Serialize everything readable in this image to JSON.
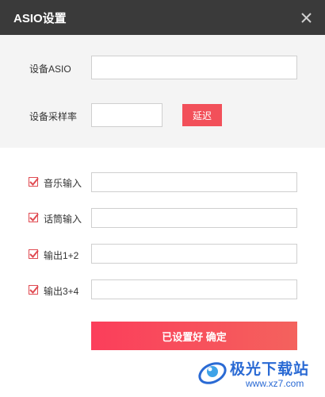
{
  "window": {
    "title": "ASIO设置"
  },
  "device": {
    "label": "设备ASIO",
    "value": ""
  },
  "sample_rate": {
    "label": "设备采样率",
    "value": "",
    "delay_label": "延迟"
  },
  "inputs": [
    {
      "label": "音乐输入",
      "checked": true,
      "value": ""
    },
    {
      "label": "话筒输入",
      "checked": true,
      "value": ""
    },
    {
      "label": "输出1+2",
      "checked": true,
      "value": ""
    },
    {
      "label": "输出3+4",
      "checked": true,
      "value": ""
    }
  ],
  "confirm": {
    "label": "已设置好 确定"
  },
  "watermark": {
    "name": "极光下载站",
    "url": "www.xz7.com"
  },
  "colors": {
    "titlebar": "#3a3a3a",
    "accent": "#f2505a",
    "checkbox": "#e04b52",
    "watermark": "#2a6ad4"
  },
  "icons": {
    "close": "close-icon",
    "check": "check-icon",
    "logo": "aurora-logo-icon"
  }
}
